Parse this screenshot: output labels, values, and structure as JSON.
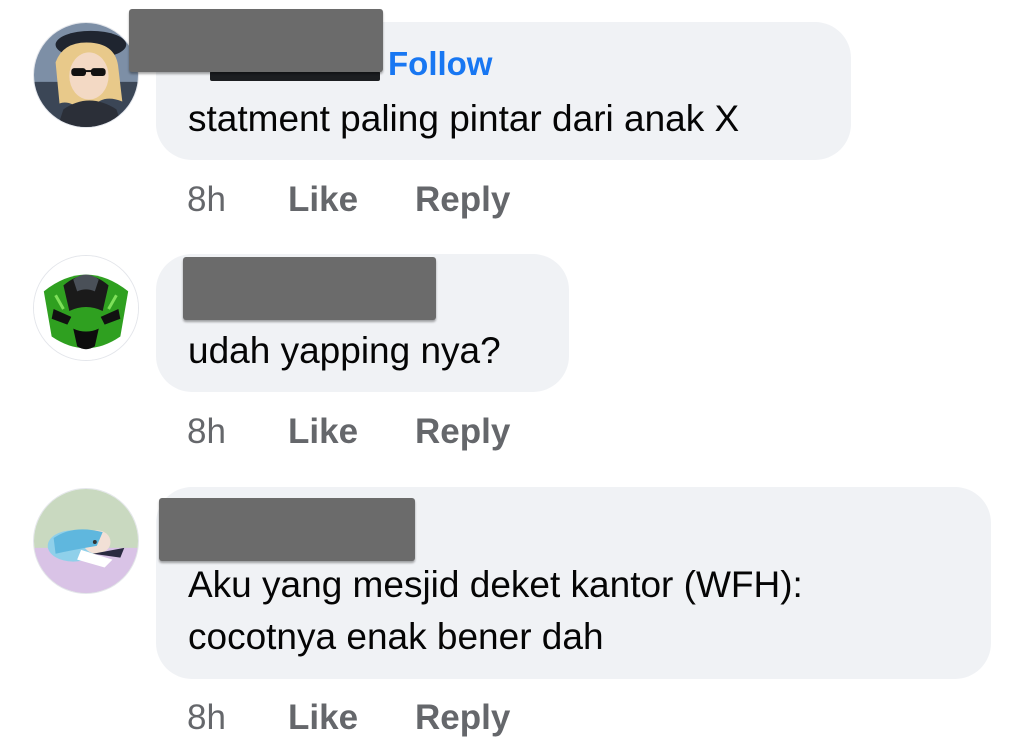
{
  "colors": {
    "bubble": "#f0f2f5",
    "link": "#1877f2",
    "muted": "#65676b",
    "redaction": "#6b6b6b"
  },
  "comments": [
    {
      "avatar_icon": "anime-girl-with-sunglasses-avatar",
      "author_redacted": true,
      "follow_label": "Follow",
      "text_lines": [
        "statment paling pintar dari anak X"
      ],
      "time": "8h",
      "like_label": "Like",
      "reply_label": "Reply"
    },
    {
      "avatar_icon": "green-motorcycle-avatar",
      "author_redacted": true,
      "text_lines": [
        "udah yapping nya?"
      ],
      "time": "8h",
      "like_label": "Like",
      "reply_label": "Reply"
    },
    {
      "avatar_icon": "anime-character-lying-avatar",
      "author_redacted": true,
      "text_lines": [
        "Aku yang mesjid deket kantor (WFH):",
        "cocotnya enak bener dah"
      ],
      "time": "8h",
      "like_label": "Like",
      "reply_label": "Reply"
    }
  ]
}
